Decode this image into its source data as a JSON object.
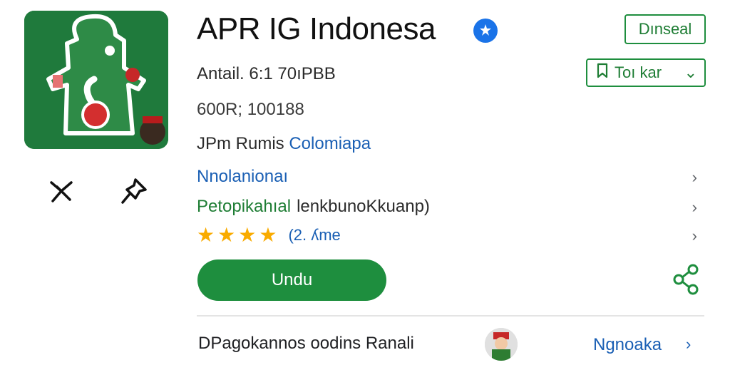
{
  "app": {
    "title": "APR IG Indonesa",
    "verified_icon": "verified-badge-icon",
    "icon_name": "app-logo-icon"
  },
  "header": {
    "top_button_label": "Dınseal",
    "select_label": "Toı kar",
    "select_icon": "bookmark-outline-icon"
  },
  "meta": {
    "line1": "Antail. 6:1 70ıPBB",
    "line2": "600R; 100188",
    "line3_prefix": "JPm Rumis",
    "line3_link": "Colomiapa"
  },
  "rows": [
    {
      "text": "Nnolanionaı"
    },
    {
      "green": "Petopikahıal",
      "dark": "lenkbunoKkuanp)"
    },
    {
      "rating_text": "(2. ʎme",
      "stars": 4
    }
  ],
  "install": {
    "label": "Undu"
  },
  "left_actions": [
    "pin-icon",
    "pushpin-icon"
  ],
  "footer": {
    "text": "DPagokannos oodins Ranali",
    "link": "Ngnoaka",
    "chevron": "›"
  },
  "chevron": "›",
  "dropdown_chevron": "⌄",
  "colors": {
    "green": "#1e8e3e",
    "link_blue": "#1a5fb4",
    "star": "#f9ab00",
    "icon_bg": "#1f7a3c"
  }
}
